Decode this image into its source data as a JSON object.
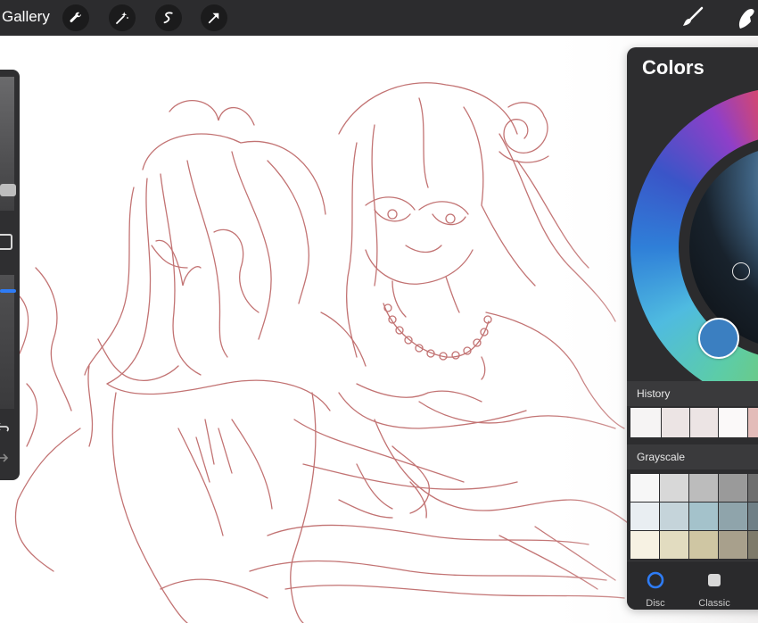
{
  "toolbar": {
    "gallery_label": "Gallery",
    "left_tools": [
      "wrench-icon",
      "magic-wand-icon",
      "selection-icon",
      "transform-arrow-icon"
    ],
    "right_tools": [
      "brush-icon",
      "smudge-icon"
    ]
  },
  "sidebar": {
    "tools": [
      "brush-size-slider",
      "modify-button",
      "opacity-slider",
      "undo-icon",
      "redo-icon"
    ]
  },
  "colors_panel": {
    "title": "Colors",
    "active_color": "#3b7fc1",
    "history_label": "History",
    "history_swatches": [
      "#f6f4f4",
      "#ece4e4",
      "#ece4e4",
      "#fbf9f9",
      "#e3bcb9"
    ],
    "grayscale_label": "Grayscale",
    "grayscale_swatches": [
      [
        "#f7f7f7",
        "#d8d8d8",
        "#bcbcbc",
        "#9a9a9a",
        "#6e6e6e"
      ],
      [
        "#e9eef2",
        "#c5d4da",
        "#a4c2cb",
        "#8fa4ab",
        "#6f7f86"
      ],
      [
        "#f7f2e3",
        "#e2dcc0",
        "#cfc6a3",
        "#a8a08c",
        "#7e7a6a"
      ]
    ],
    "tabs": [
      {
        "label": "Disc",
        "active": true
      },
      {
        "label": "Classic",
        "active": false
      }
    ],
    "accent": "#2e7cf6"
  },
  "canvas": {
    "sketch_color": "#b85b5b",
    "background": "#ffffff"
  }
}
